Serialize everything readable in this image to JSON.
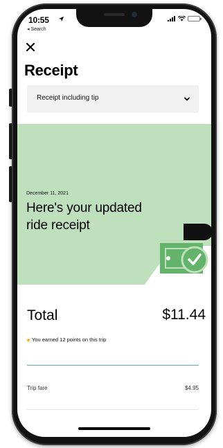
{
  "status_bar": {
    "time": "10:55",
    "back_label": "◂ Search"
  },
  "header": {
    "title": "Receipt"
  },
  "selector": {
    "value": "Receipt including tip"
  },
  "hero": {
    "date": "December 11, 2021",
    "heading": "Here's your updated ride receipt"
  },
  "summary": {
    "total_label": "Total",
    "total_value": "$11.44",
    "points_text": "You earned 12 points on this trip"
  },
  "line_items": [
    {
      "label": "Trip fare",
      "value": "$4.95"
    }
  ],
  "colors": {
    "hero_green": "#bfe0bd",
    "accent_green": "#64b36a",
    "points_star": "#f2a900",
    "divider_teal": "#5fa8a3"
  },
  "icons": [
    "location-arrow-icon",
    "signal-icon",
    "wifi-icon",
    "battery-icon",
    "close-icon",
    "chevron-down-icon",
    "star-icon",
    "check-icon"
  ]
}
